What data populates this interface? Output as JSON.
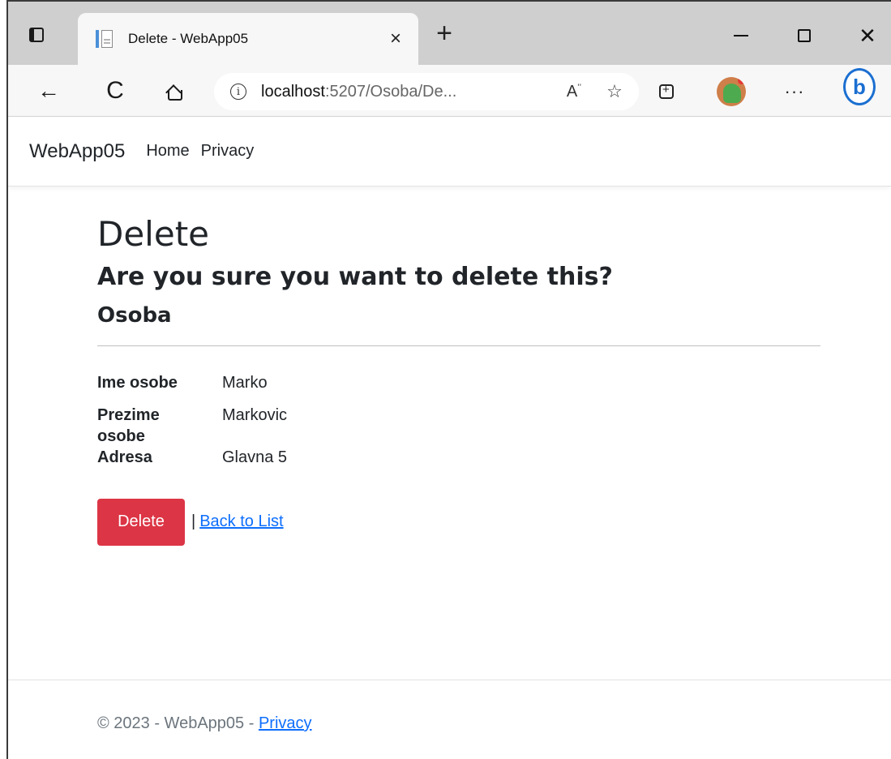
{
  "browser": {
    "tab_title": "Delete - WebApp05",
    "tab_close": "×",
    "new_tab": "+",
    "close_window": "✕",
    "url_host": "localhost",
    "url_rest": ":5207/Osoba/De...",
    "read_aloud": "A̅)",
    "favorite_icon": "☆",
    "more_label": "···",
    "back_glyph": "←",
    "reload_glyph": "C",
    "info_glyph": "i",
    "bing_glyph": "b"
  },
  "site": {
    "brand": "WebApp05",
    "nav": [
      "Home",
      "Privacy"
    ]
  },
  "content": {
    "title": "Delete",
    "question": "Are you sure you want to delete this?",
    "entity": "Osoba",
    "fields": [
      {
        "label": "Ime osobe",
        "value": "Marko"
      },
      {
        "label": "Prezime osobe",
        "value": "Markovic"
      },
      {
        "label": "Adresa",
        "value": "Glavna 5"
      }
    ],
    "delete_button": "Delete",
    "separator": "|",
    "back_link": "Back to List"
  },
  "footer": {
    "text": "© 2023 - WebApp05 - ",
    "privacy_link": "Privacy"
  },
  "colors": {
    "danger": "#dc3545",
    "link": "#0d6efd"
  }
}
